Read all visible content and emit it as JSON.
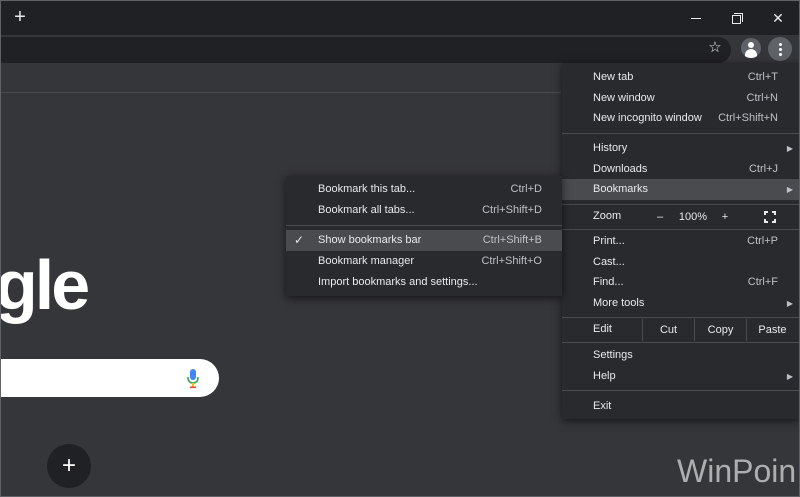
{
  "window": {
    "new_tab_symbol": "+",
    "close_symbol": "✕"
  },
  "toolbar": {
    "star_symbol": "☆"
  },
  "page": {
    "logo_text": "gle",
    "add_shortcut_symbol": "+",
    "watermark": "WinPoin"
  },
  "menu": {
    "new_tab": {
      "label": "New tab",
      "shortcut": "Ctrl+T"
    },
    "new_window": {
      "label": "New window",
      "shortcut": "Ctrl+N"
    },
    "new_incognito": {
      "label": "New incognito window",
      "shortcut": "Ctrl+Shift+N"
    },
    "history": {
      "label": "History"
    },
    "downloads": {
      "label": "Downloads",
      "shortcut": "Ctrl+J"
    },
    "bookmarks": {
      "label": "Bookmarks"
    },
    "zoom": {
      "label": "Zoom",
      "minus": "–",
      "level": "100%",
      "plus": "+"
    },
    "print": {
      "label": "Print...",
      "shortcut": "Ctrl+P"
    },
    "cast": {
      "label": "Cast..."
    },
    "find": {
      "label": "Find...",
      "shortcut": "Ctrl+F"
    },
    "more_tools": {
      "label": "More tools"
    },
    "edit": {
      "label": "Edit",
      "cut": "Cut",
      "copy": "Copy",
      "paste": "Paste"
    },
    "settings": {
      "label": "Settings"
    },
    "help": {
      "label": "Help"
    },
    "exit": {
      "label": "Exit"
    },
    "arrow_symbol": "▶"
  },
  "submenu": {
    "bookmark_tab": {
      "label": "Bookmark this tab...",
      "shortcut": "Ctrl+D"
    },
    "bookmark_all": {
      "label": "Bookmark all tabs...",
      "shortcut": "Ctrl+Shift+D"
    },
    "show_bar": {
      "label": "Show bookmarks bar",
      "shortcut": "Ctrl+Shift+B",
      "check": "✓"
    },
    "manager": {
      "label": "Bookmark manager",
      "shortcut": "Ctrl+Shift+O"
    },
    "import": {
      "label": "Import bookmarks and settings..."
    }
  },
  "colors": {
    "menu_bg": "#292a2d",
    "highlight": "#4a4b4f",
    "page_bg": "#35363a",
    "titlebar_bg": "#202124"
  }
}
